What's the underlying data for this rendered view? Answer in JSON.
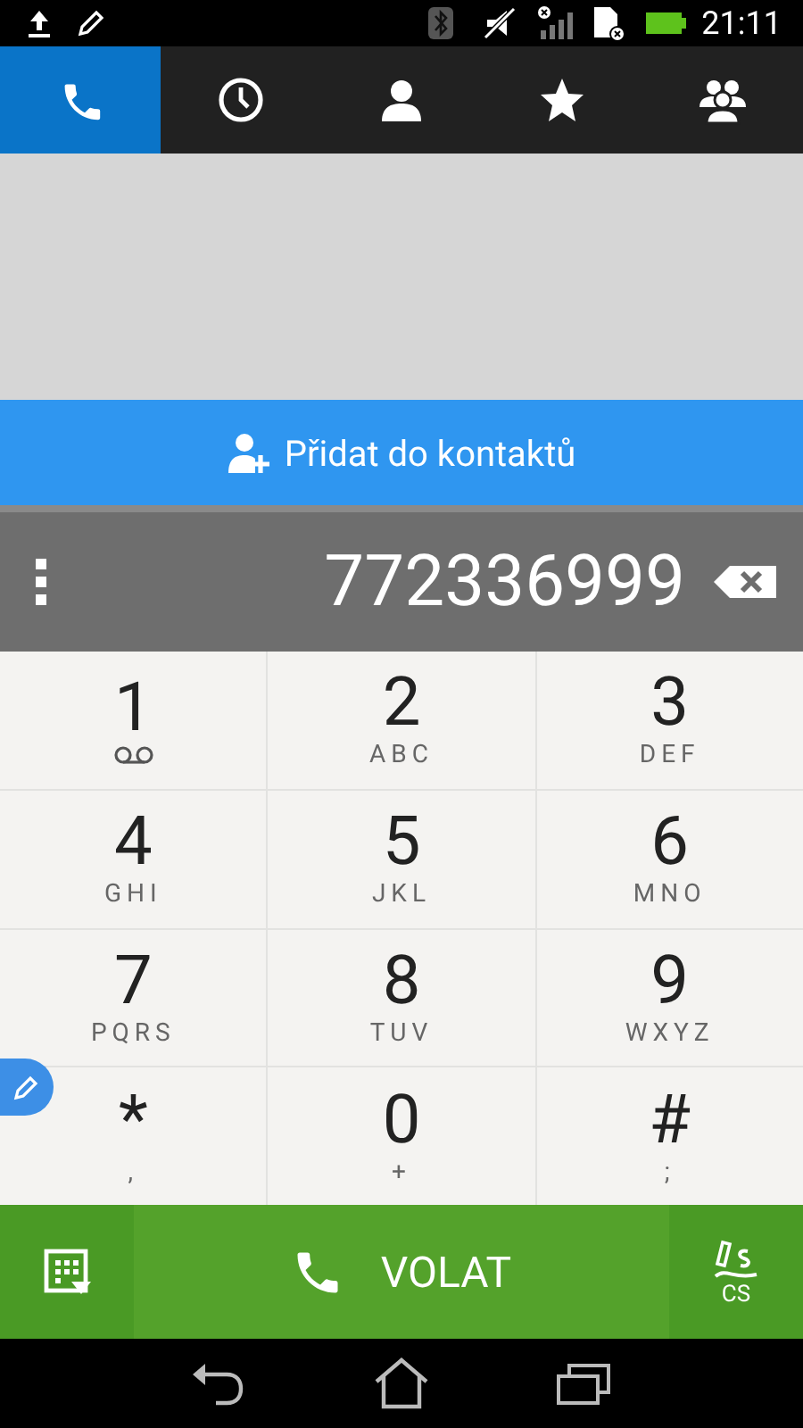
{
  "status_bar": {
    "time": "21:11"
  },
  "tabs": [
    {
      "kind": "phone",
      "selected": true
    },
    {
      "kind": "history",
      "selected": false
    },
    {
      "kind": "contact",
      "selected": false
    },
    {
      "kind": "favorites",
      "selected": false
    },
    {
      "kind": "groups",
      "selected": false
    }
  ],
  "add_contact": {
    "label": "Přidat do kontaktů"
  },
  "number": {
    "value": "772336999"
  },
  "keys": [
    {
      "digit": "1",
      "kind": "voicemail"
    },
    {
      "digit": "2",
      "letters": "ABC"
    },
    {
      "digit": "3",
      "letters": "DEF"
    },
    {
      "digit": "4",
      "letters": "GHI"
    },
    {
      "digit": "5",
      "letters": "JKL"
    },
    {
      "digit": "6",
      "letters": "MNO"
    },
    {
      "digit": "7",
      "letters": "PQRS"
    },
    {
      "digit": "8",
      "letters": "TUV"
    },
    {
      "digit": "9",
      "letters": "WXYZ"
    },
    {
      "digit": "*",
      "letters": ","
    },
    {
      "digit": "0",
      "letters": "+"
    },
    {
      "digit": "#",
      "letters": ";"
    }
  ],
  "call_button": {
    "label": "VOLAT"
  },
  "handwriting": {
    "label": "CS"
  }
}
